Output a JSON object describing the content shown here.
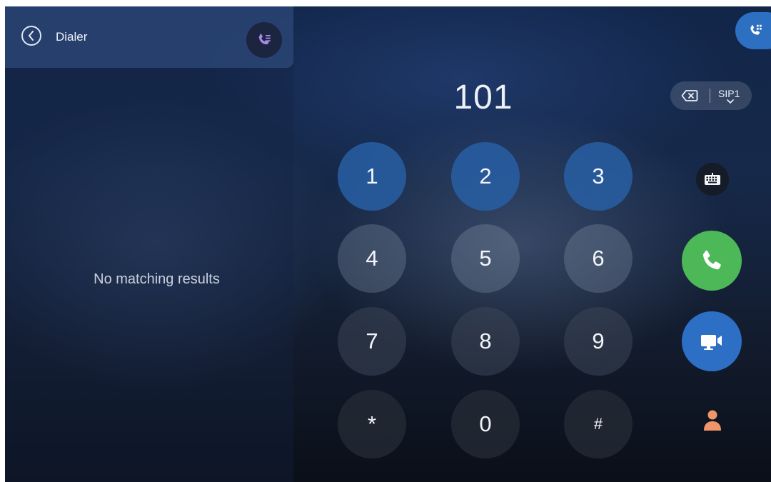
{
  "header": {
    "title": "Dialer",
    "back_icon": "chevron-left-icon",
    "history_icon": "call-history-icon"
  },
  "results": {
    "empty_text": "No matching results"
  },
  "dialer": {
    "number": "101",
    "line": "SIP1",
    "keys": {
      "k1": "1",
      "k2": "2",
      "k3": "3",
      "k4": "4",
      "k5": "5",
      "k6": "6",
      "k7": "7",
      "k8": "8",
      "k9": "9",
      "kstar": "*",
      "k0": "0",
      "khash": "#"
    }
  },
  "actions": {
    "keyboard_icon": "keyboard-icon",
    "call_icon": "phone-icon",
    "video_icon": "video-camera-icon",
    "contact_icon": "contact-icon",
    "delete_icon": "backspace-icon"
  },
  "colors": {
    "call": "#4cb858",
    "video": "#2c6fc4",
    "contact": "#f0956a",
    "accent": "#2d6fc0"
  }
}
